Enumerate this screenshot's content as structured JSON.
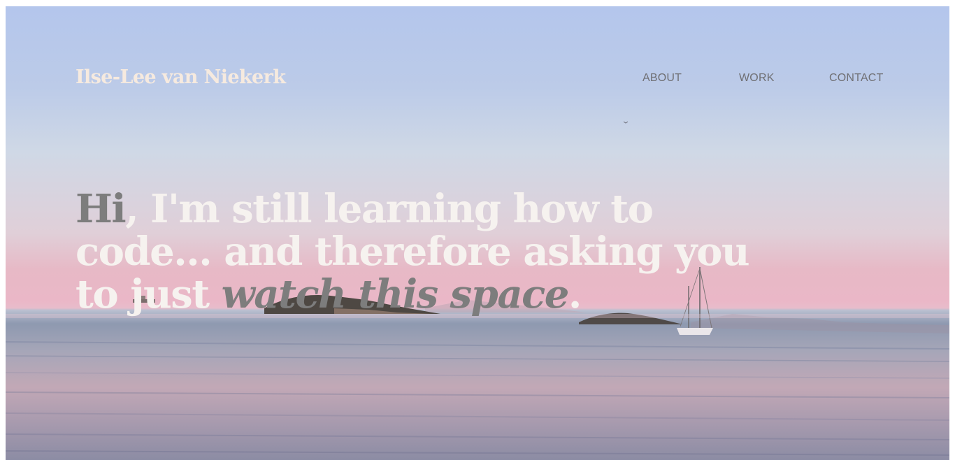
{
  "site": {
    "name": "Ilse-Lee van Niekerk"
  },
  "nav": {
    "about": "ABOUT",
    "work": "WORK",
    "contact": "CONTACT"
  },
  "hero": {
    "greeting": "Hi",
    "line_a": ", I'm still learning how to code... and therefore asking you to just ",
    "highlight": "watch this space",
    "line_end": ".",
    "background_image": "sunset-sea-with-islands-and-sailboat"
  },
  "colors": {
    "logo": "#f6eadf",
    "nav": "#6f6f73",
    "headline": "#f6f2ef",
    "accent": "#7d7d7d"
  }
}
